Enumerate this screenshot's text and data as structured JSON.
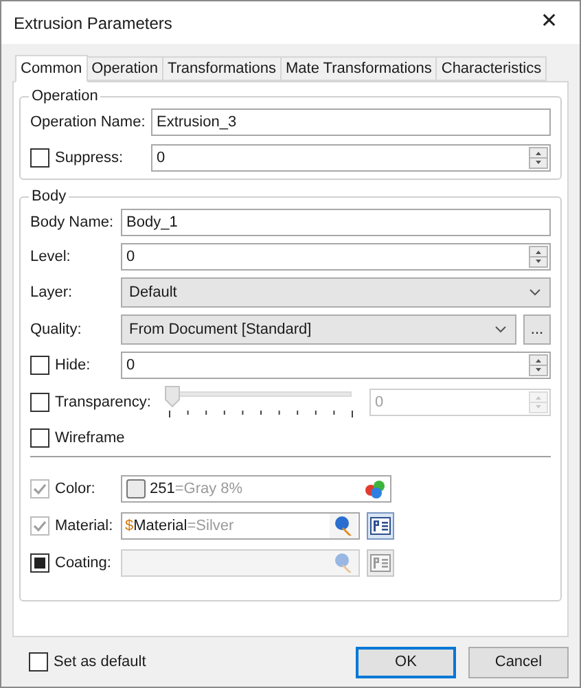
{
  "window": {
    "title": "Extrusion Parameters",
    "close": "✕"
  },
  "tabs": [
    {
      "label": "Common",
      "selected": true
    },
    {
      "label": "Operation",
      "selected": false
    },
    {
      "label": "Transformations",
      "selected": false
    },
    {
      "label": "Mate Transformations",
      "selected": false
    },
    {
      "label": "Characteristics",
      "selected": false
    }
  ],
  "operation_group": {
    "title": "Operation",
    "name_label": "Operation Name:",
    "name_value": "Extrusion_3",
    "suppress": {
      "label": "Suppress:",
      "checked": false,
      "value": "0"
    }
  },
  "body_group": {
    "title": "Body",
    "rows": [
      {
        "kind": "text",
        "label": "Body Name:",
        "value": "Body_1"
      },
      {
        "kind": "spin",
        "label": "Level:",
        "value": "0"
      },
      {
        "kind": "select",
        "label": "Layer:",
        "value": "Default"
      },
      {
        "kind": "select_more",
        "label": "Quality:",
        "value": "From Document [Standard]",
        "more": "..."
      },
      {
        "kind": "check_spin",
        "label": "Hide:",
        "checked": false,
        "value": "0"
      },
      {
        "kind": "check_slider",
        "label": "Transparency:",
        "checked": false,
        "level": 0,
        "value": "0"
      },
      {
        "kind": "check",
        "label": "Wireframe",
        "checked": false
      }
    ],
    "appearance": [
      {
        "kind": "color",
        "label": "Color:",
        "checked": true,
        "disabled": true,
        "value": "251",
        "suffix": "=Gray 8%"
      },
      {
        "kind": "material",
        "label": "Material:",
        "checked": true,
        "disabled": true,
        "sigil": "$",
        "value": "Material",
        "suffix": "=Silver",
        "enabled": true
      },
      {
        "kind": "material",
        "label": "Coating:",
        "indeterminate": true,
        "disabled": false,
        "enabled": false
      }
    ]
  },
  "footer": {
    "default_checkbox": {
      "label": "Set as default",
      "checked": false
    },
    "buttons": [
      {
        "label": "OK",
        "default": true
      },
      {
        "label": "Cancel",
        "default": false
      }
    ]
  }
}
